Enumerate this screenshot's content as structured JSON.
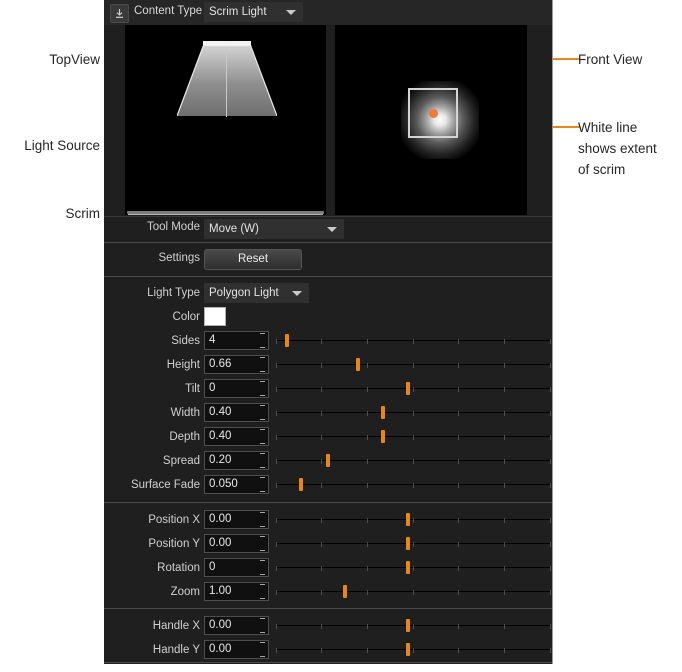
{
  "annotations": {
    "left": [
      {
        "label": "TopView",
        "name": "annotation-topview"
      },
      {
        "label": "Light Source",
        "name": "annotation-light-source"
      },
      {
        "label": "Scrim",
        "name": "annotation-scrim"
      }
    ],
    "right": [
      {
        "label": "Front View",
        "name": "annotation-front-view"
      },
      {
        "label": "White line\nshows extent\nof scrim",
        "name": "annotation-white-line"
      }
    ],
    "line_color": "#E8861A"
  },
  "topbar": {
    "import_icon": "import-icon",
    "content_type_label": "Content Type",
    "content_type_value": "Scrim Light"
  },
  "viewports": {
    "topview_name": "TopView",
    "frontview_name": "Front View"
  },
  "toolmode": {
    "label": "Tool Mode",
    "value": "Move (W)"
  },
  "settings": {
    "label": "Settings",
    "reset_label": "Reset"
  },
  "light": {
    "type_label": "Light Type",
    "type_value": "Polygon Light",
    "color_label": "Color",
    "color_value": "#FFFFFF",
    "params": [
      {
        "label": "Sides",
        "value": "4",
        "handle": 4,
        "name": "sides"
      },
      {
        "label": "Height",
        "value": "0.66",
        "handle": 30,
        "name": "height"
      },
      {
        "label": "Tilt",
        "value": "0",
        "handle": 48,
        "name": "tilt"
      },
      {
        "label": "Width",
        "value": "0.40",
        "handle": 39,
        "name": "width"
      },
      {
        "label": "Depth",
        "value": "0.40",
        "handle": 39,
        "name": "depth"
      },
      {
        "label": "Spread",
        "value": "0.20",
        "handle": 19,
        "name": "spread"
      },
      {
        "label": "Surface Fade",
        "value": "0.050",
        "handle": 9,
        "name": "surface-fade"
      }
    ]
  },
  "transform": {
    "params": [
      {
        "label": "Position X",
        "value": "0.00",
        "handle": 48,
        "name": "position-x"
      },
      {
        "label": "Position Y",
        "value": "0.00",
        "handle": 48,
        "name": "position-y"
      },
      {
        "label": "Rotation",
        "value": "0",
        "handle": 48,
        "name": "rotation"
      },
      {
        "label": "Zoom",
        "value": "1.00",
        "handle": 25,
        "name": "zoom"
      }
    ]
  },
  "handle": {
    "params": [
      {
        "label": "Handle X",
        "value": "0.00",
        "handle": 48,
        "name": "handle-x"
      },
      {
        "label": "Handle Y",
        "value": "0.00",
        "handle": 48,
        "name": "handle-y"
      }
    ]
  },
  "colors": {
    "accent": "#E8861A",
    "panel_bg": "#1f1f1f",
    "viewport_bg": "#000000",
    "light_dot": "#F07A3C"
  }
}
